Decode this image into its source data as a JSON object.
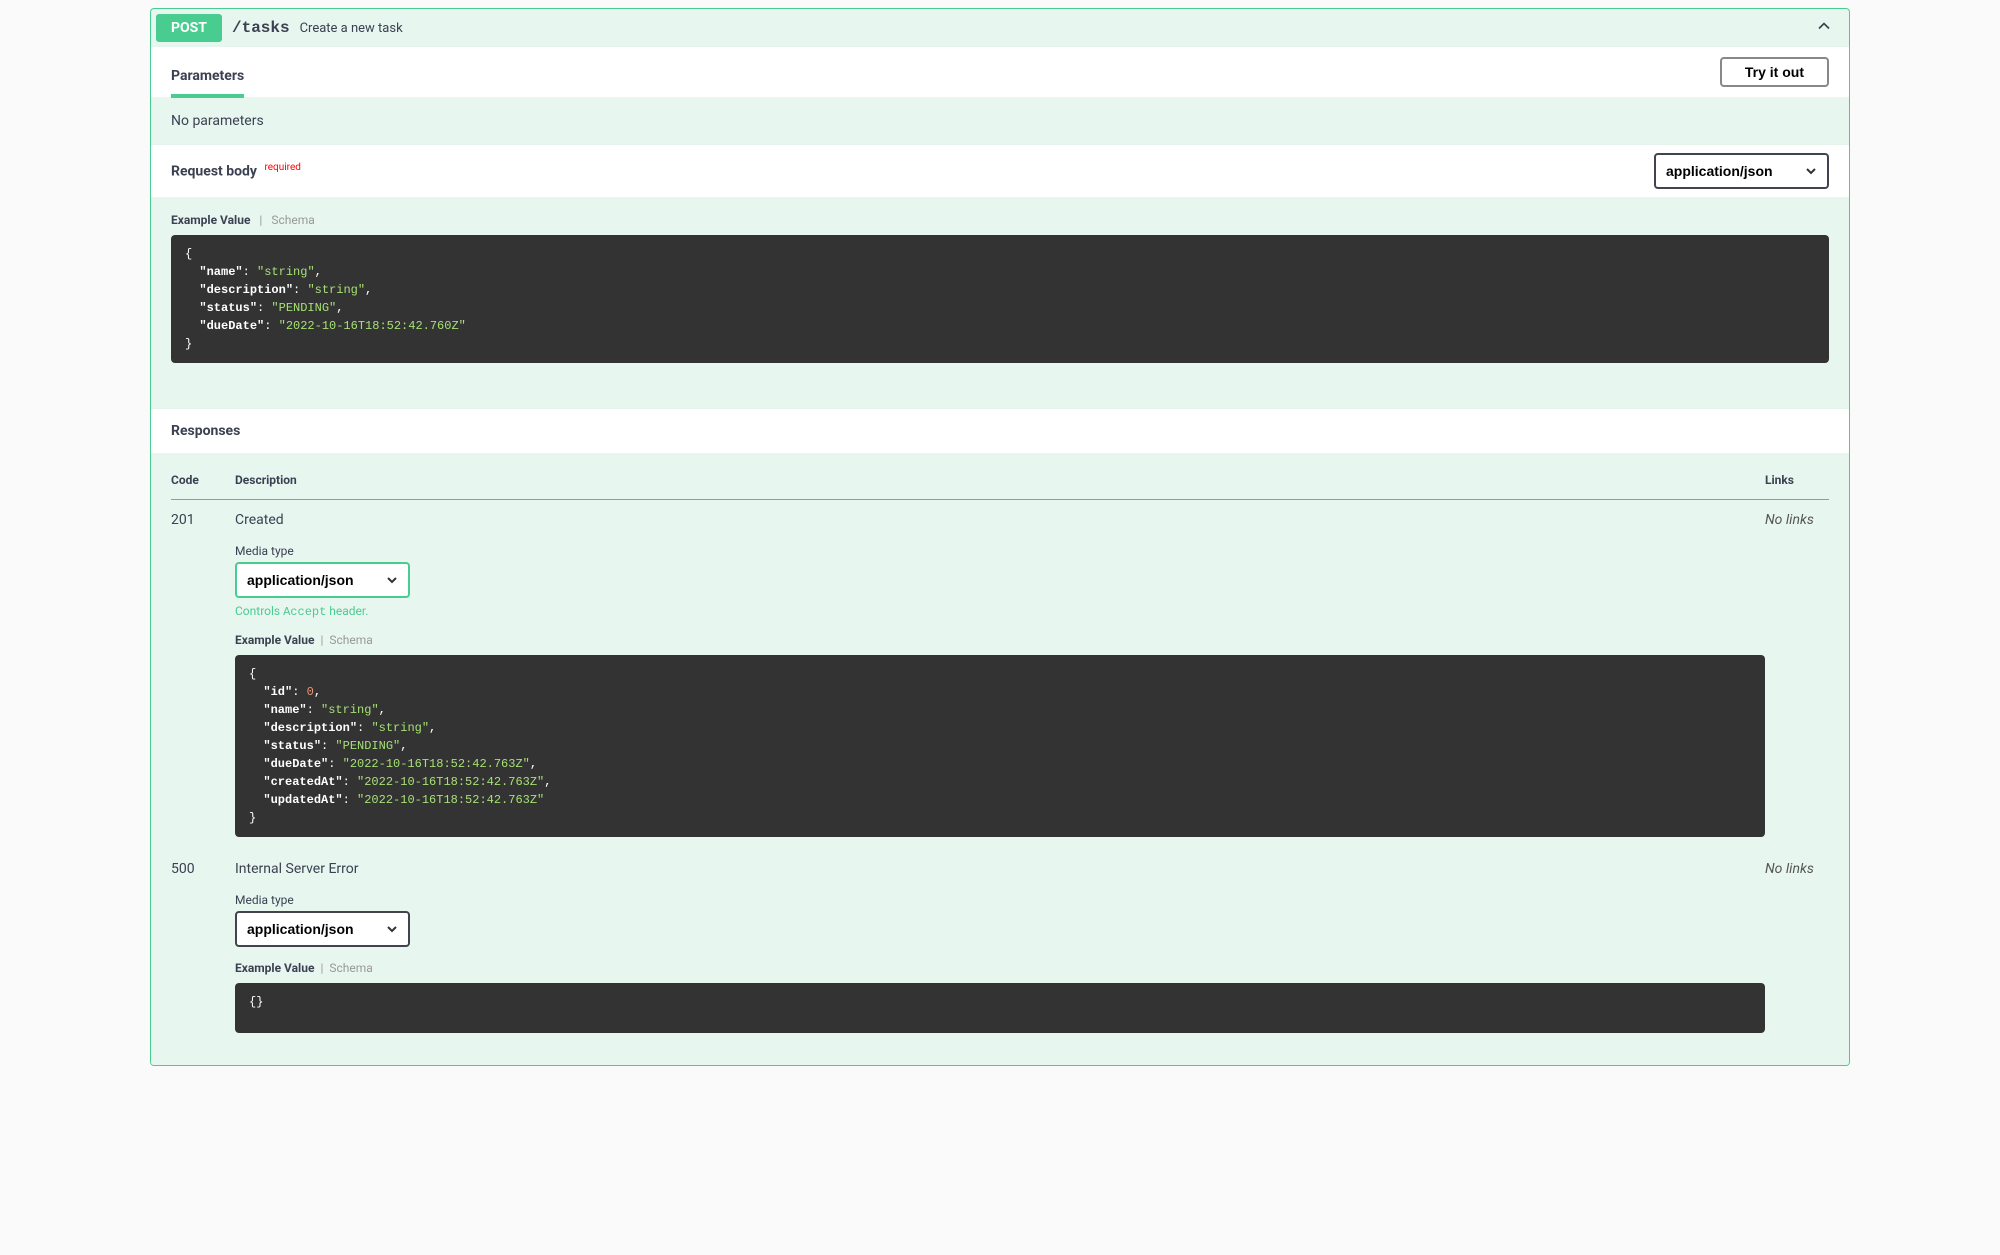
{
  "summary": {
    "method": "POST",
    "path": "/tasks",
    "description": "Create a new task"
  },
  "parameters": {
    "tab_label": "Parameters",
    "try_out_label": "Try it out",
    "empty_message": "No parameters"
  },
  "request_body": {
    "title": "Request body",
    "required_label": "required",
    "content_type": "application/json",
    "tab_example": "Example Value",
    "tab_schema": "Schema",
    "example_lines": [
      {
        "type": "brace",
        "text": "{"
      },
      {
        "type": "kv",
        "indent": 1,
        "key": "\"name\"",
        "value": "\"string\"",
        "vtype": "string",
        "comma": true
      },
      {
        "type": "kv",
        "indent": 1,
        "key": "\"description\"",
        "value": "\"string\"",
        "vtype": "string",
        "comma": true
      },
      {
        "type": "kv",
        "indent": 1,
        "key": "\"status\"",
        "value": "\"PENDING\"",
        "vtype": "string",
        "comma": true
      },
      {
        "type": "kv",
        "indent": 1,
        "key": "\"dueDate\"",
        "value": "\"2022-10-16T18:52:42.760Z\"",
        "vtype": "string",
        "comma": false
      },
      {
        "type": "brace",
        "text": "}"
      }
    ]
  },
  "responses": {
    "header": "Responses",
    "col_code": "Code",
    "col_description": "Description",
    "col_links": "Links",
    "rows": [
      {
        "code": "201",
        "description": "Created",
        "media_type_label": "Media type",
        "content_type": "application/json",
        "controls_prefix": "Controls ",
        "controls_accept": "Accept",
        "controls_suffix": " header.",
        "tab_example": "Example Value",
        "tab_schema": "Schema",
        "green_border": true,
        "example_lines": [
          {
            "type": "brace",
            "text": "{"
          },
          {
            "type": "kv",
            "indent": 1,
            "key": "\"id\"",
            "value": "0",
            "vtype": "number",
            "comma": true
          },
          {
            "type": "kv",
            "indent": 1,
            "key": "\"name\"",
            "value": "\"string\"",
            "vtype": "string",
            "comma": true
          },
          {
            "type": "kv",
            "indent": 1,
            "key": "\"description\"",
            "value": "\"string\"",
            "vtype": "string",
            "comma": true
          },
          {
            "type": "kv",
            "indent": 1,
            "key": "\"status\"",
            "value": "\"PENDING\"",
            "vtype": "string",
            "comma": true
          },
          {
            "type": "kv",
            "indent": 1,
            "key": "\"dueDate\"",
            "value": "\"2022-10-16T18:52:42.763Z\"",
            "vtype": "string",
            "comma": true
          },
          {
            "type": "kv",
            "indent": 1,
            "key": "\"createdAt\"",
            "value": "\"2022-10-16T18:52:42.763Z\"",
            "vtype": "string",
            "comma": true
          },
          {
            "type": "kv",
            "indent": 1,
            "key": "\"updatedAt\"",
            "value": "\"2022-10-16T18:52:42.763Z\"",
            "vtype": "string",
            "comma": false
          },
          {
            "type": "brace",
            "text": "}"
          }
        ],
        "links": "No links"
      },
      {
        "code": "500",
        "description": "Internal Server Error",
        "media_type_label": "Media type",
        "content_type": "application/json",
        "tab_example": "Example Value",
        "tab_schema": "Schema",
        "green_border": false,
        "example_lines": [
          {
            "type": "brace",
            "text": "{}"
          }
        ],
        "links": "No links"
      }
    ]
  }
}
